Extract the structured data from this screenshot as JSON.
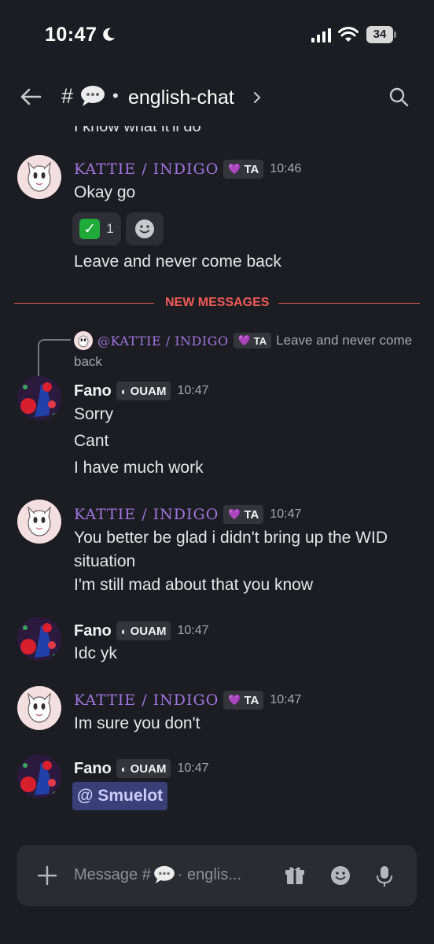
{
  "status_bar": {
    "time": "10:47",
    "battery": "34"
  },
  "header": {
    "hash": "#",
    "separator": "•",
    "channel_name": "english-chat",
    "icons": [
      "back-arrow-icon",
      "speech-bubble-icon",
      "chevron-right-icon",
      "search-icon"
    ]
  },
  "cut_text": "I know what it'll do",
  "messages": [
    {
      "author": "KATTIE / INDIGO",
      "tag": "TA",
      "time": "10:46",
      "lines": [
        "Okay go"
      ]
    },
    {
      "author": "KATTIE / INDIGO",
      "lines": [
        "Leave and never come back"
      ]
    }
  ],
  "reactions": {
    "check_count": "1"
  },
  "divider": "NEW MESSAGES",
  "reply": {
    "author": "@KATTIE / INDIGO",
    "tag": "TA",
    "text": "Leave and never come",
    "text_cont": "back"
  },
  "fano_1": {
    "author": "Fano",
    "tag": "OUAM",
    "time": "10:47",
    "lines": [
      "Sorry",
      "Cant",
      "I have much work"
    ]
  },
  "kattie_2": {
    "author": "KATTIE / INDIGO",
    "tag": "TA",
    "time": "10:47",
    "lines": [
      "You better be glad i didn't bring up the WID",
      "situation",
      "I'm still mad about that you know"
    ]
  },
  "fano_2": {
    "author": "Fano",
    "tag": "OUAM",
    "time": "10:47",
    "lines": [
      "Idc yk"
    ]
  },
  "kattie_3": {
    "author": "KATTIE / INDIGO",
    "tag": "TA",
    "time": "10:47",
    "lines": [
      "Im sure you don't"
    ]
  },
  "fano_3": {
    "author": "Fano",
    "tag": "OUAM",
    "time": "10:47",
    "mention": "@ Smuelot"
  },
  "input": {
    "placeholder_pre": "Message #",
    "placeholder_post": "· englis..."
  },
  "colors": {
    "background": "#1c1d22",
    "accent_purple": "#a074e0",
    "new_messages_red": "#f05b57",
    "mention_bg": "#3b3f78"
  }
}
